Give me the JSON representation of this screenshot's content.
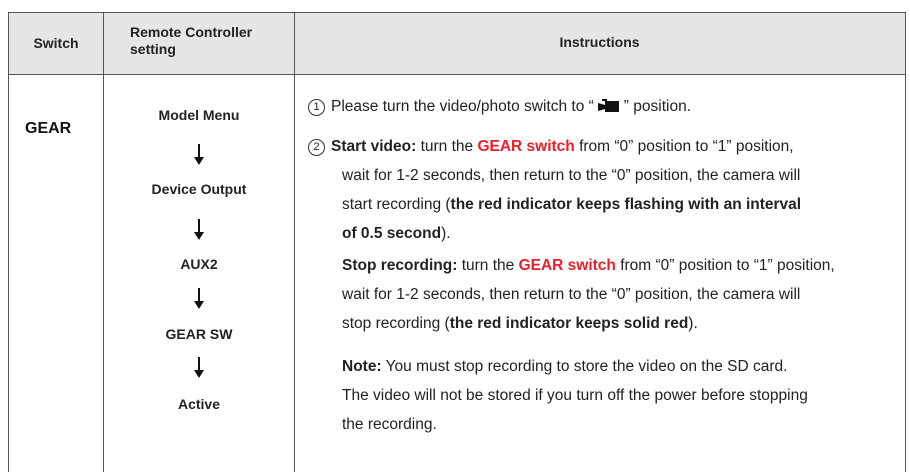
{
  "header": {
    "switch": "Switch",
    "remote_controller_setting": "Remote Controller setting",
    "instructions": "Instructions"
  },
  "row": {
    "switch": "GEAR",
    "flow": [
      "Model Menu",
      "Device Output",
      "AUX2",
      "GEAR SW",
      "Active"
    ],
    "arrow_icon": "down-arrow-icon",
    "instructions": {
      "step1_num": "1",
      "step1_pre": "Please turn the video/photo switch to “",
      "step1_icon": "video-camera-icon",
      "step1_post": "” position.",
      "step2_num": "2",
      "start_label": "Start video:",
      "start_l1_a": "turn the",
      "start_l1_red": "GEAR switch",
      "start_l1_b": "from “0” position to “1” position,",
      "start_l2": "wait for 1-2 seconds, then return to the “0” position, the camera will",
      "start_l3_a": "start recording (",
      "start_l3_bold": "the red indicator keeps flashing with an interval",
      "start_l4_bold": "of 0.5 second",
      "start_l4_b": ").",
      "stop_label": "Stop recording:",
      "stop_l1_a": "turn the",
      "stop_l1_red": "GEAR switch",
      "stop_l1_b": "from “0” position to “1” position,",
      "stop_l2": "wait for 1-2 seconds, then return to the “0” position, the camera will",
      "stop_l3_a": "stop recording (",
      "stop_l3_bold": "the red indicator keeps solid red",
      "stop_l3_b": ").",
      "note_label": "Note:",
      "note_l1": "You must stop recording to store the video on the SD card.",
      "note_l2": "The video will not be stored if you turn off the power before stopping",
      "note_l3": "the recording."
    }
  },
  "colors": {
    "header_bg": "#e6e6e6",
    "accent_red": "#e8202a",
    "border": "#555555"
  }
}
